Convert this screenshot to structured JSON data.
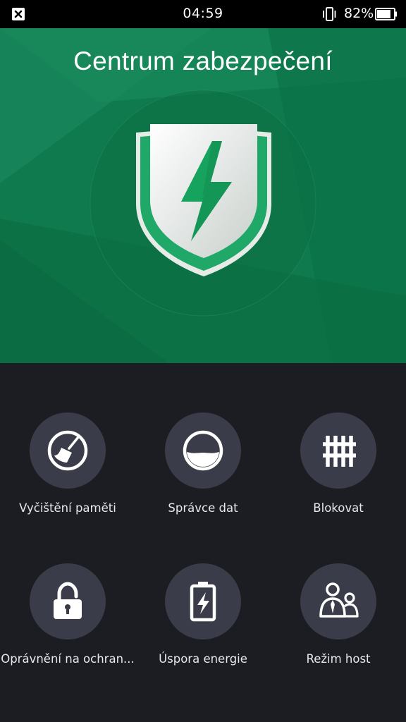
{
  "status_bar": {
    "time": "04:59",
    "battery_percent": "82%",
    "battery_level": 0.82,
    "icons": [
      "close-notification-icon",
      "vibrate-icon",
      "battery-icon"
    ]
  },
  "hero": {
    "title": "Centrum zabezpečení",
    "icon": "shield-lightning-icon",
    "colors": {
      "background": "#0e7a4d",
      "accent": "#1db56e",
      "shield": "#e8ebe9"
    }
  },
  "features": [
    {
      "label": "Vyčištění paměti",
      "icon": "broom-clean-icon"
    },
    {
      "label": "Správce dat",
      "icon": "data-gauge-icon"
    },
    {
      "label": "Blokovat",
      "icon": "fence-block-icon"
    },
    {
      "label": "Oprávnění na ochran...",
      "icon": "padlock-icon"
    },
    {
      "label": "Úspora energie",
      "icon": "battery-saver-icon"
    },
    {
      "label": "Režim host",
      "icon": "guest-users-icon"
    }
  ],
  "colors": {
    "grid_background": "#1c1d22",
    "tile_circle": "#3a3d49",
    "label_text": "#e8e8ec"
  }
}
